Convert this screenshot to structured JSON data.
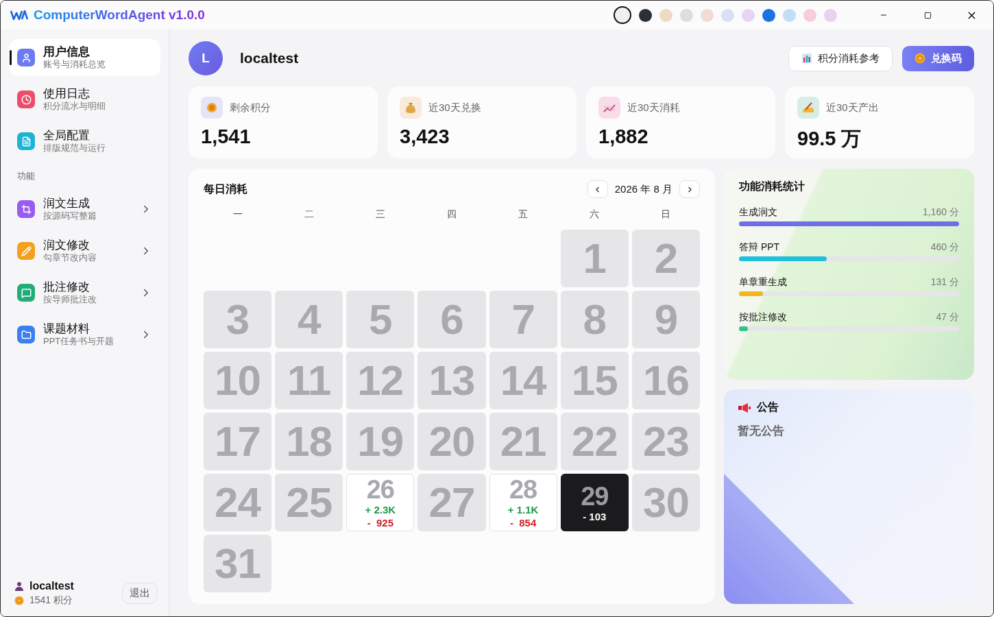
{
  "app": {
    "title": "ComputerWordAgent v1.0.0"
  },
  "theme_swatches": [
    {
      "color": "#f0f0f3",
      "selected": true
    },
    {
      "color": "#2b2f36",
      "selected": false
    },
    {
      "color": "#ecdcc4",
      "selected": false
    },
    {
      "color": "#dcdce1",
      "selected": false
    },
    {
      "color": "#f1dbd4",
      "selected": false
    },
    {
      "color": "#dadff4",
      "selected": false
    },
    {
      "color": "#e5d5f0",
      "selected": false
    },
    {
      "color": "#1a73e0",
      "selected": false
    },
    {
      "color": "#c2def6",
      "selected": false
    },
    {
      "color": "#f6cedb",
      "selected": false
    },
    {
      "color": "#e6d2f2",
      "selected": false
    }
  ],
  "sidebar": {
    "top_items": [
      {
        "title": "用户信息",
        "subtitle": "账号与消耗总览",
        "kind": "user",
        "selected": true
      },
      {
        "title": "使用日志",
        "subtitle": "积分流水与明细",
        "kind": "clock",
        "selected": false
      },
      {
        "title": "全局配置",
        "subtitle": "排版规范与运行",
        "kind": "list",
        "selected": false
      }
    ],
    "section_label": "功能",
    "feature_items": [
      {
        "title": "润文生成",
        "subtitle": "按源码写整篇",
        "kind": "crop",
        "selected": false
      },
      {
        "title": "润文修改",
        "subtitle": "勾章节改内容",
        "kind": "pencil",
        "selected": false
      },
      {
        "title": "批注修改",
        "subtitle": "按导师批注改",
        "kind": "message",
        "selected": false
      },
      {
        "title": "课题材料",
        "subtitle": "PPT任务书与开题",
        "kind": "folder",
        "selected": false
      }
    ],
    "footer": {
      "username": "localtest",
      "points": "1541 积分",
      "logout": "退出"
    }
  },
  "header": {
    "avatar_letter": "L",
    "username": "localtest",
    "buttons": [
      {
        "label": "积分消耗参考",
        "kind": "secondary"
      },
      {
        "label": "兑换码",
        "kind": "primary"
      }
    ]
  },
  "stats": [
    {
      "kind": "coin",
      "label": "剩余积分",
      "value": "1,541"
    },
    {
      "kind": "bag",
      "label": "近30天兑换",
      "value": "3,423"
    },
    {
      "kind": "chart",
      "label": "近30天消耗",
      "value": "1,882"
    },
    {
      "kind": "hand",
      "label": "近30天产出",
      "value": "99.5 万"
    }
  ],
  "calendar": {
    "title": "每日消耗",
    "month": "2026 年 8 月",
    "weekdays": [
      "一",
      "二",
      "三",
      "四",
      "五",
      "六",
      "日"
    ],
    "days": [
      {
        "kind": "blank"
      },
      {
        "kind": "blank"
      },
      {
        "kind": "blank"
      },
      {
        "kind": "blank"
      },
      {
        "kind": "blank"
      },
      {
        "kind": "plain",
        "day": "1",
        "selected": false
      },
      {
        "kind": "plain",
        "day": "2",
        "selected": false
      },
      {
        "kind": "plain",
        "day": "3",
        "selected": false
      },
      {
        "kind": "plain",
        "day": "4",
        "selected": false
      },
      {
        "kind": "plain",
        "day": "5",
        "selected": false
      },
      {
        "kind": "plain",
        "day": "6",
        "selected": false
      },
      {
        "kind": "plain",
        "day": "7",
        "selected": false
      },
      {
        "kind": "plain",
        "day": "8",
        "selected": false
      },
      {
        "kind": "plain",
        "day": "9",
        "selected": false
      },
      {
        "kind": "plain",
        "day": "10",
        "selected": false
      },
      {
        "kind": "plain",
        "day": "11",
        "selected": false
      },
      {
        "kind": "plain",
        "day": "12",
        "selected": false
      },
      {
        "kind": "plain",
        "day": "13",
        "selected": false
      },
      {
        "kind": "plain",
        "day": "14",
        "selected": false
      },
      {
        "kind": "plain",
        "day": "15",
        "selected": false
      },
      {
        "kind": "plain",
        "day": "16",
        "selected": false
      },
      {
        "kind": "plain",
        "day": "17",
        "selected": false
      },
      {
        "kind": "plain",
        "day": "18",
        "selected": false
      },
      {
        "kind": "plain",
        "day": "19",
        "selected": false
      },
      {
        "kind": "plain",
        "day": "20",
        "selected": false
      },
      {
        "kind": "plain",
        "day": "21",
        "selected": false
      },
      {
        "kind": "plain",
        "day": "22",
        "selected": false
      },
      {
        "kind": "plain",
        "day": "23",
        "selected": false
      },
      {
        "kind": "plain",
        "day": "24",
        "selected": false
      },
      {
        "kind": "plain",
        "day": "25",
        "selected": false
      },
      {
        "kind": "active",
        "day": "26",
        "plus": "+ 2.3K",
        "minus": "-  925",
        "selected": false
      },
      {
        "kind": "plain",
        "day": "27",
        "selected": false
      },
      {
        "kind": "active",
        "day": "28",
        "plus": "+ 1.1K",
        "minus": "-  854",
        "selected": false
      },
      {
        "kind": "active",
        "day": "29",
        "minus": "- 103",
        "selected": true
      },
      {
        "kind": "plain",
        "day": "30",
        "selected": false
      },
      {
        "kind": "plain",
        "day": "31",
        "selected": false
      }
    ]
  },
  "usage": {
    "title": "功能消耗统计",
    "items": [
      {
        "label": "生成润文",
        "value": "1,160 分",
        "level": 1.0,
        "color": "#6c6fe6"
      },
      {
        "label": "答辩 PPT",
        "value": "460 分",
        "level": 0.4,
        "color": "#22bfdc"
      },
      {
        "label": "单章重生成",
        "value": "131 分",
        "level": 0.11,
        "color": "#f2b71c"
      },
      {
        "label": "按批注修改",
        "value": "47 分",
        "level": 0.04,
        "color": "#2fc68a"
      }
    ]
  },
  "notice": {
    "title": "公告",
    "body": "暂无公告"
  }
}
